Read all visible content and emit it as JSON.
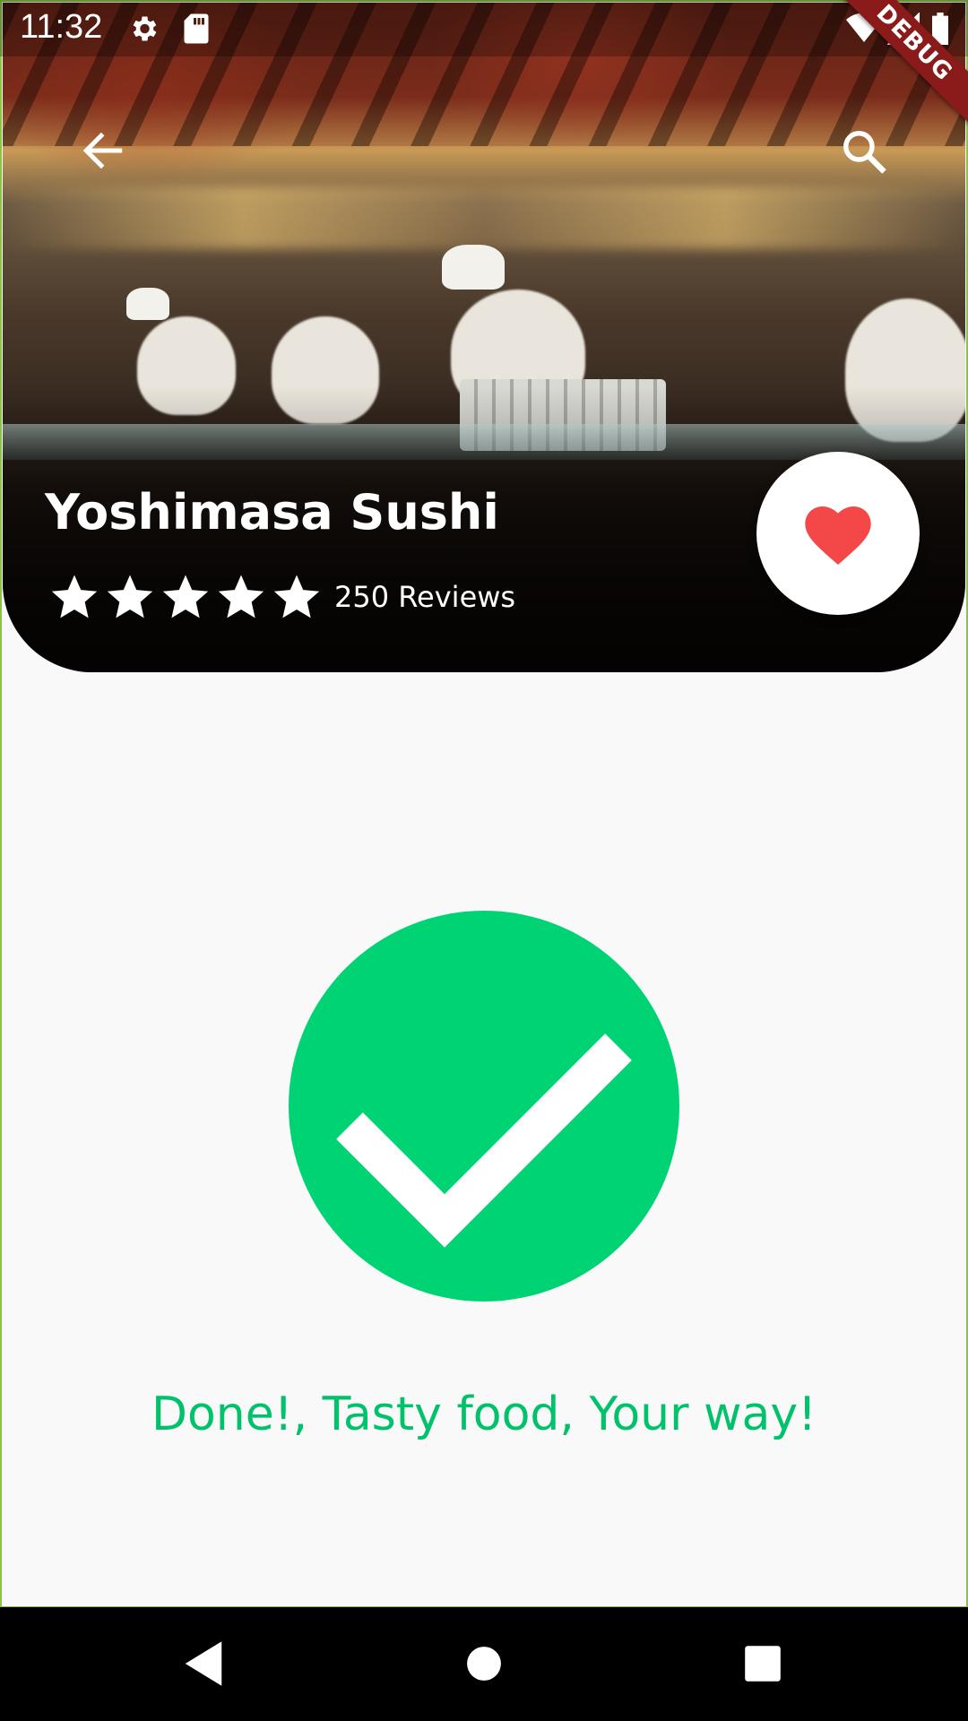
{
  "status_bar": {
    "time": "11:32",
    "icons": [
      "gear-icon",
      "sd-card-icon",
      "wifi-icon",
      "signal-icon",
      "battery-icon"
    ],
    "debug_banner": "DEBUG"
  },
  "app_bar": {
    "back_icon": "arrow-back-icon",
    "search_icon": "search-icon"
  },
  "restaurant": {
    "name": "Yoshimasa Sushi",
    "rating": 5,
    "rating_max": 5,
    "reviews_label": "250 Reviews",
    "favorite_icon": "heart-icon",
    "favorite_color": "#f44848"
  },
  "confirmation": {
    "icon": "check-icon",
    "accent_color": "#00d374",
    "message": "Done!, Tasty food, Your way!"
  },
  "nav_bar": {
    "buttons": [
      "back-triangle-icon",
      "home-circle-icon",
      "recents-square-icon"
    ]
  }
}
